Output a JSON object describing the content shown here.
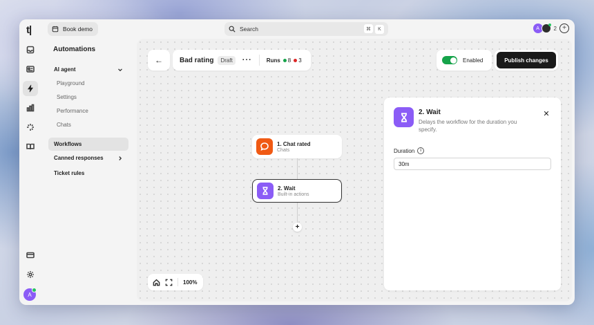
{
  "app": {
    "logo": "t|"
  },
  "topbar": {
    "book_demo": "Book demo",
    "search": {
      "label": "Search",
      "shortcut_mod": "⌘",
      "shortcut_key": "K"
    },
    "avatar_initial": "A",
    "collaborator_count": "2",
    "add_symbol": "+"
  },
  "rail": {
    "icons": [
      "inbox-icon",
      "contacts-icon",
      "automations-icon",
      "analytics-icon",
      "ai-sparkle-icon",
      "knowledge-icon",
      "billing-icon",
      "settings-icon",
      "help-icon"
    ],
    "avatar_initial": "A"
  },
  "nav": {
    "title": "Automations",
    "ai_agent": "AI agent",
    "ai_agent_items": [
      "Playground",
      "Settings",
      "Performance",
      "Chats"
    ],
    "workflows": "Workflows",
    "canned_responses": "Canned responses",
    "ticket_rules": "Ticket rules"
  },
  "workflow": {
    "back": "←",
    "name": "Bad rating",
    "status": "Draft",
    "more": "···",
    "runs_label": "Runs",
    "runs_success": "8",
    "runs_failed": "3",
    "enabled_label": "Enabled",
    "enabled": true,
    "publish": "Publish changes",
    "zoom": "100%",
    "colors": {
      "success": "#16a34a",
      "failed": "#dc2626",
      "trigger": "#f05a14",
      "action": "#8b5cf6"
    }
  },
  "nodes": [
    {
      "title": "1. Chat rated",
      "subtitle": "Chats",
      "icon": "chat-bubble-icon"
    },
    {
      "title": "2. Wait",
      "subtitle": "Built-in actions",
      "icon": "hourglass-icon"
    }
  ],
  "add_step": "+",
  "panel": {
    "title": "2. Wait",
    "description": "Delays the workflow for the duration you specify.",
    "close": "✕",
    "field_label": "Duration",
    "info": "i",
    "duration_value": "30m"
  }
}
